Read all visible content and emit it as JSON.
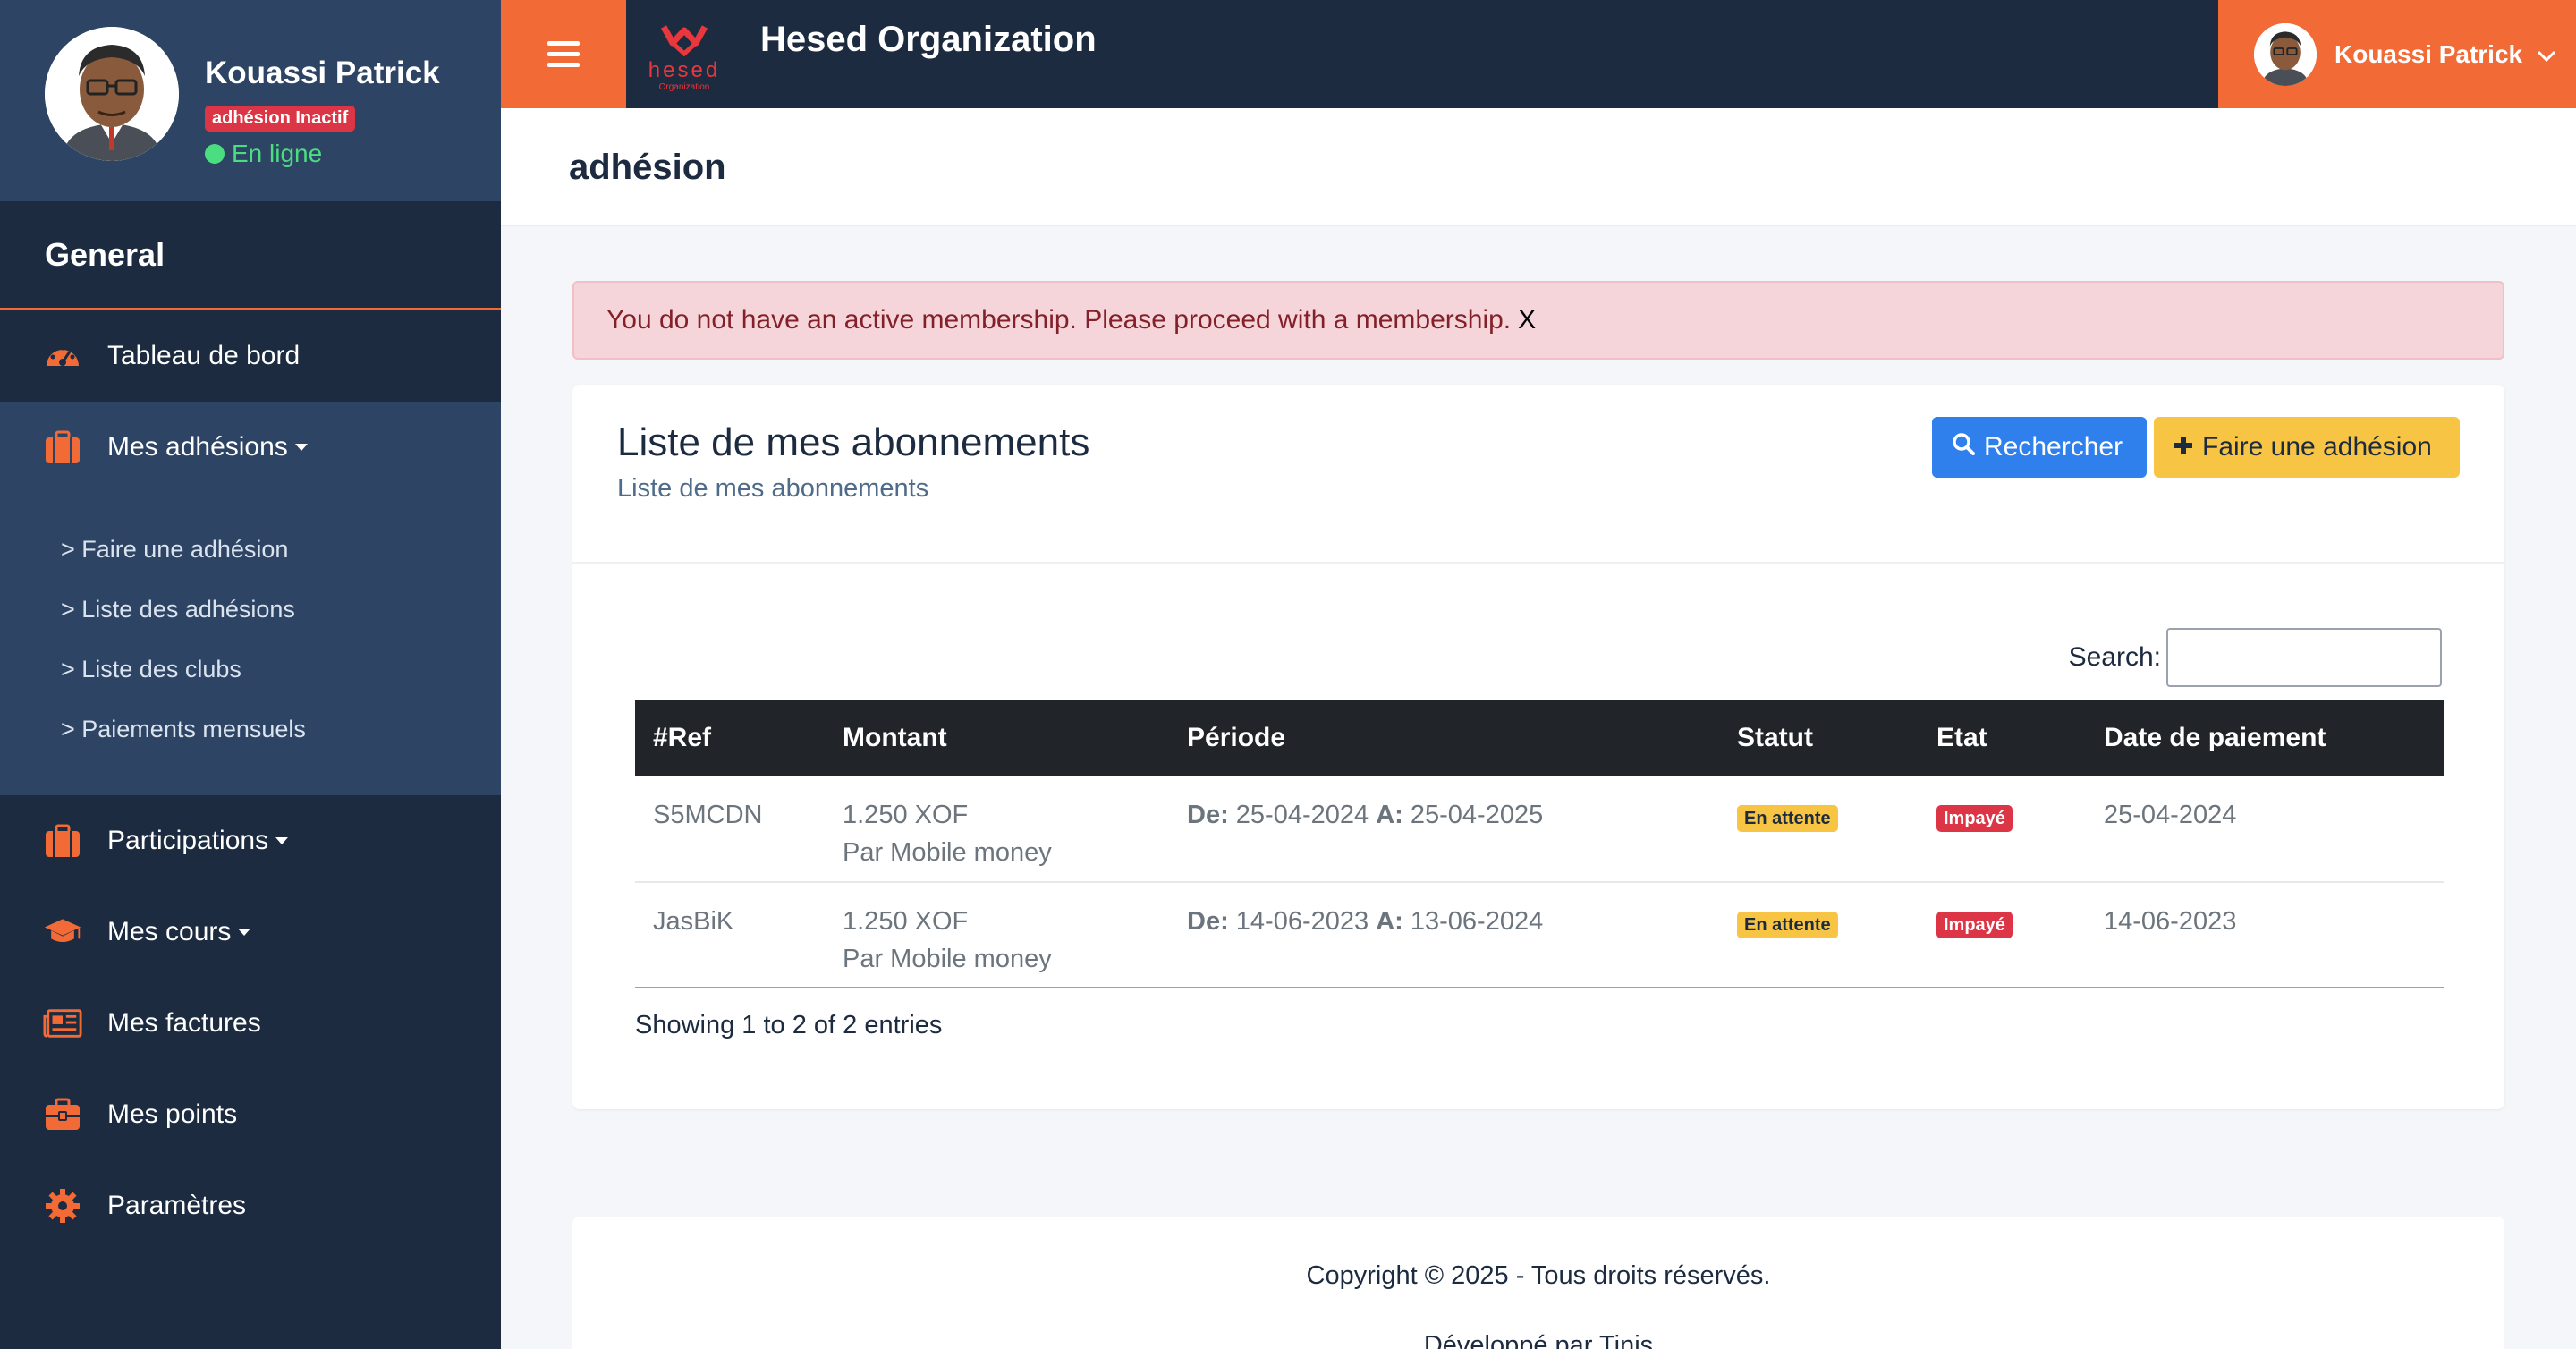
{
  "sidebar": {
    "user": {
      "name": "Kouassi Patrick",
      "badge": "adhésion Inactif",
      "status": "En ligne"
    },
    "section_title": "General",
    "items": [
      {
        "label": "Tableau de bord",
        "icon": "dashboard-gauge-icon"
      },
      {
        "label": "Mes adhésions",
        "icon": "briefcase-icon"
      },
      {
        "label": "Participations",
        "icon": "briefcase-icon"
      },
      {
        "label": "Mes cours",
        "icon": "graduation-cap-icon"
      },
      {
        "label": "Mes factures",
        "icon": "newspaper-icon"
      },
      {
        "label": "Mes points",
        "icon": "toolbox-icon"
      },
      {
        "label": "Paramètres",
        "icon": "gear-icon"
      }
    ],
    "subitems": [
      {
        "label": "> Faire une adhésion"
      },
      {
        "label": "> Liste des adhésions"
      },
      {
        "label": "> Liste des clubs"
      },
      {
        "label": "> Paiements mensuels"
      }
    ]
  },
  "topbar": {
    "brand": "Hesed Organization",
    "logo_text": "hesed",
    "logo_sub": "Organization",
    "user_name": "Kouassi Patrick"
  },
  "page": {
    "title": "adhésion"
  },
  "alert": {
    "message": "You do not have an active membership. Please proceed with a membership.",
    "close": "X"
  },
  "card": {
    "title": "Liste de mes abonnements",
    "subtitle": "Liste de mes abonnements",
    "search_button": "Rechercher",
    "add_button": "Faire une adhésion",
    "search_label": "Search:",
    "search_value": "",
    "columns": [
      "#Ref",
      "Montant",
      "Période",
      "Statut",
      "Etat",
      "Date de paiement"
    ],
    "rows": [
      {
        "ref": "S5MCDN",
        "amount": "1.250 XOF",
        "method": "Par Mobile money",
        "from_label": "De:",
        "from": "25-04-2024",
        "to_label": "A:",
        "to": "25-04-2025",
        "statut": "En attente",
        "etat": "Impayé",
        "date": "25-04-2024"
      },
      {
        "ref": "JasBiK",
        "amount": "1.250 XOF",
        "method": "Par Mobile money",
        "from_label": "De:",
        "from": "14-06-2023",
        "to_label": "A:",
        "to": "13-06-2024",
        "statut": "En attente",
        "etat": "Impayé",
        "date": "14-06-2023"
      }
    ],
    "entries_info": "Showing 1 to 2 of 2 entries"
  },
  "footer": {
    "copyright": "Copyright © 2025 - Tous droits réservés.",
    "developer": "Développé par Tinis"
  },
  "colors": {
    "sidebar": "#1c2b3f",
    "sidebar_active": "#2d4464",
    "accent": "#f26a36",
    "primary": "#2f80ed",
    "warning": "#f8c443",
    "danger": "#dc3545",
    "alert_bg": "#f6d5da"
  }
}
